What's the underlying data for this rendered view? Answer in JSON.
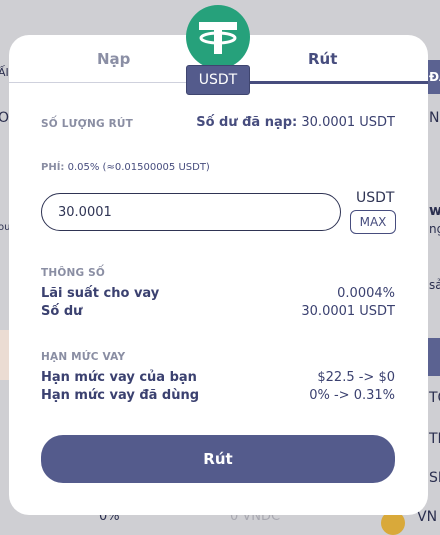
{
  "background": {
    "left_texts": [
      "ẤI",
      "O",
      "ou"
    ],
    "right_texts": [
      "ĐÁ",
      "NI",
      "w",
      "ng",
      "sả",
      "TO",
      "TH",
      "SE",
      "VN"
    ],
    "bottom_texts": [
      "0%",
      "0 VNDC"
    ]
  },
  "coin": {
    "symbol": "USDT",
    "color": "#26a17b"
  },
  "tabs": {
    "deposit": "Nạp",
    "withdraw": "Rút"
  },
  "withdraw": {
    "amount_label": "SỐ LƯỢNG RÚT",
    "balance_label": "Số dư đã nạp:",
    "balance_value": "30.0001 USDT",
    "fee_label": "PHÍ:",
    "fee_value": "0.05% (≈0.01500005 USDT)",
    "amount_value": "30.0001",
    "amount_unit": "USDT",
    "max_label": "MAX"
  },
  "params": {
    "section_label": "THÔNG SỐ",
    "rate_label": "Lãi suất cho vay",
    "rate_value": "0.0004%",
    "balance_label": "Số dư",
    "balance_value": "30.0001 USDT"
  },
  "limits": {
    "section_label": "HẠN MỨC VAY",
    "your_limit_label": "Hạn mức vay của bạn",
    "your_limit_value": "$22.5 -> $0",
    "used_limit_label": "Hạn mức vay đã dùng",
    "used_limit_value": "0% -> 0.31%"
  },
  "submit_label": "Rút"
}
